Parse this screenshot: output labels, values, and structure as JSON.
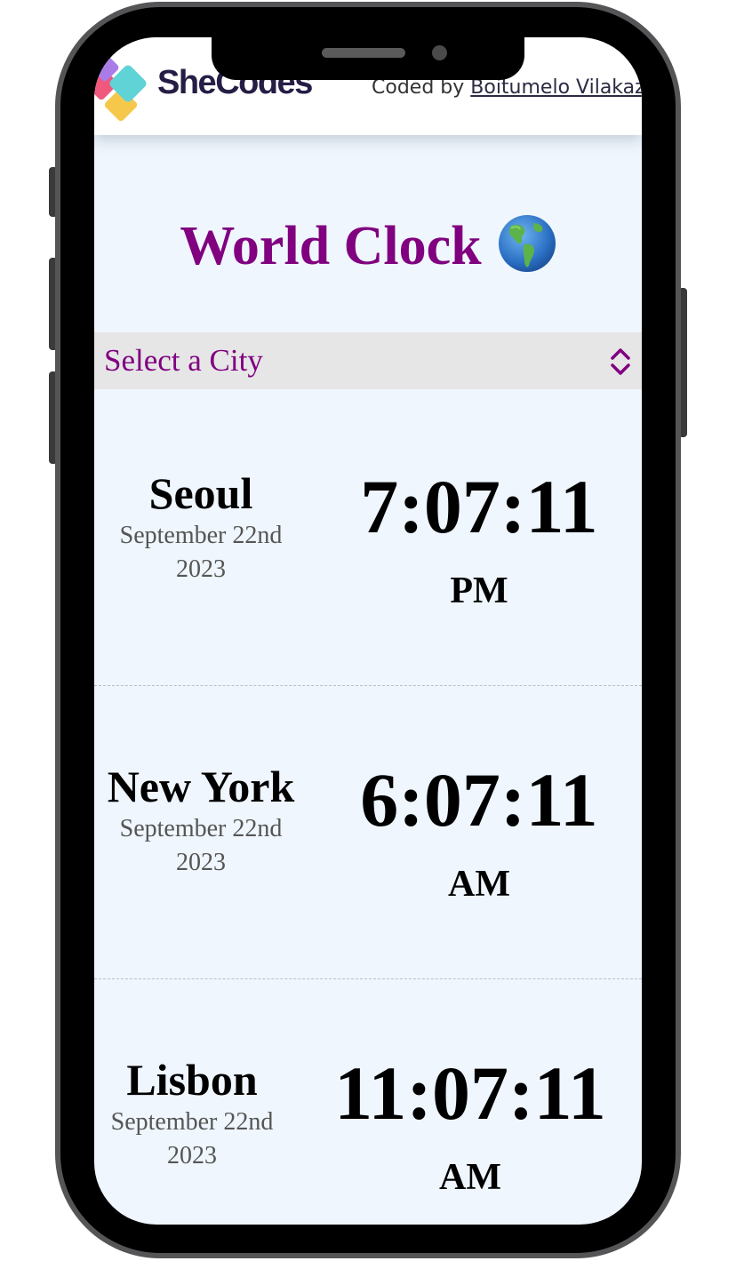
{
  "header": {
    "logo_text": "SheCodes",
    "coded_by_prefix": "Coded by ",
    "author_link": "Boitumelo Vilakazi"
  },
  "title": {
    "text": "World Clock",
    "icon": "globe-americas-icon"
  },
  "city_select": {
    "placeholder": "Select a City",
    "icon": "chevron-up-down-icon"
  },
  "cities": [
    {
      "name": "Seoul",
      "date": "September 22nd\n2023",
      "time": "7:07:11",
      "ampm": "PM"
    },
    {
      "name": "New York",
      "date": "September 22nd\n2023",
      "time": "6:07:11",
      "ampm": "AM"
    },
    {
      "name": "Lisbon",
      "date": "September 22nd\n2023",
      "time": "11:07:11",
      "ampm": "AM"
    }
  ],
  "colors": {
    "accent": "#800080",
    "background": "#eff6fd",
    "select_background": "#e6e6e6",
    "logo_text": "#261d45"
  }
}
